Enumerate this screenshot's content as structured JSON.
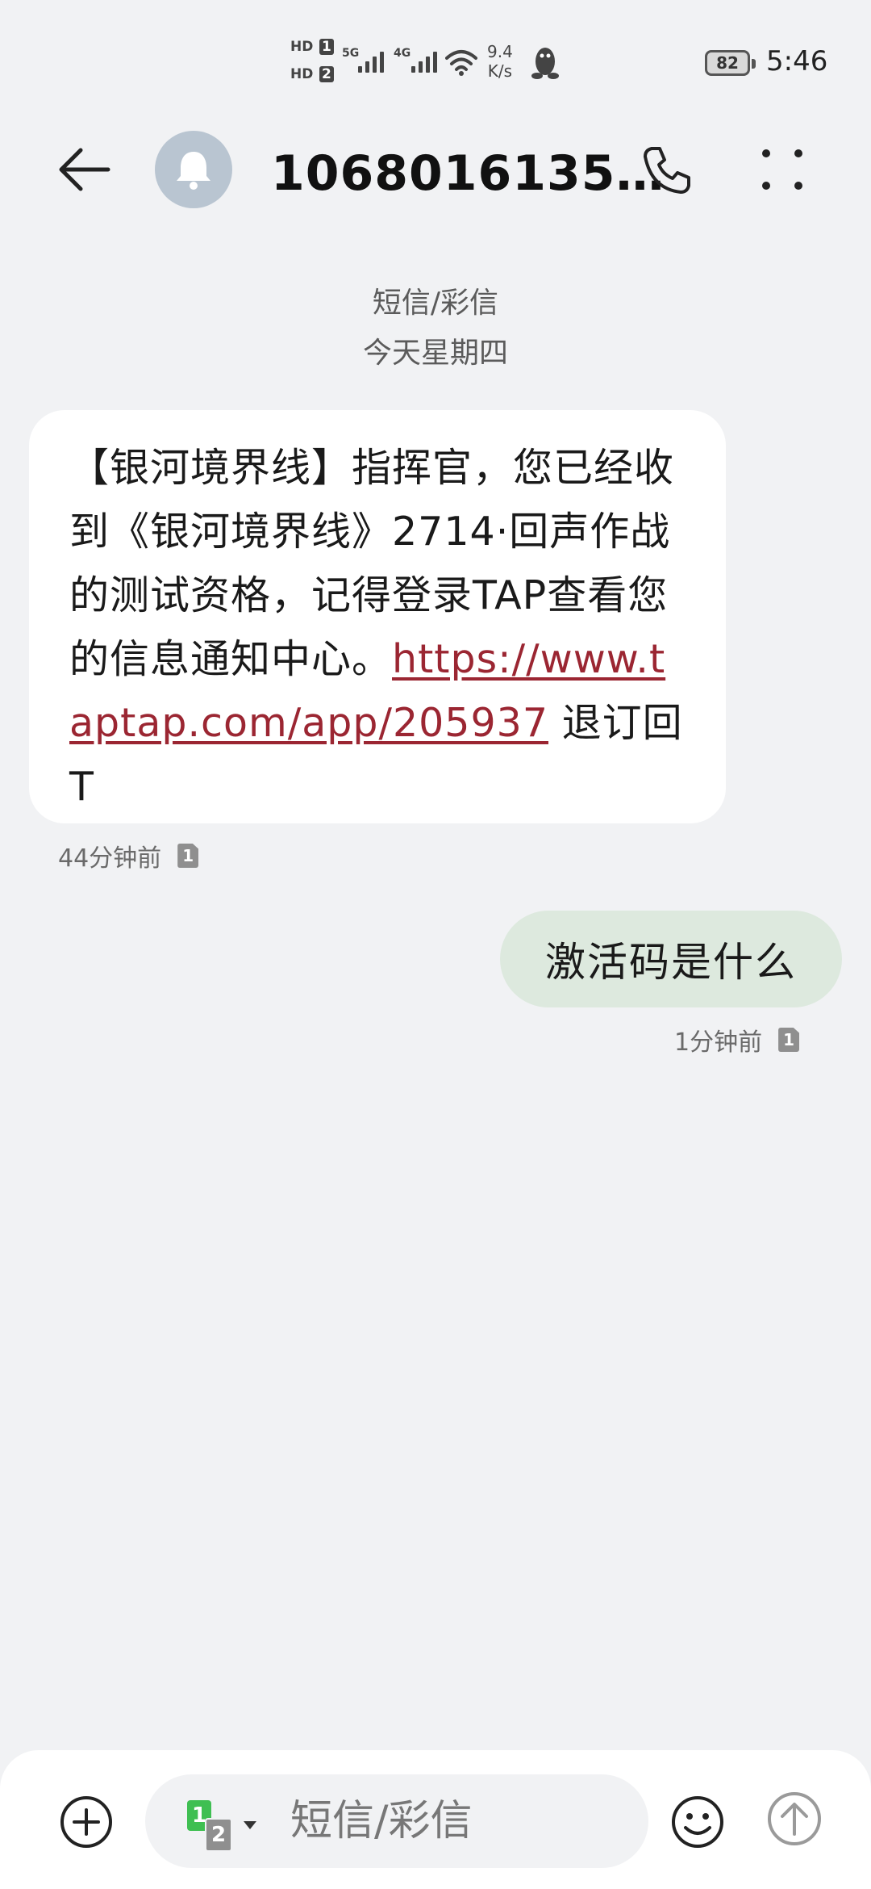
{
  "status_bar": {
    "hd1": "HD",
    "hd1_num": "1",
    "hd2": "HD",
    "hd2_num": "2",
    "net1": "5G",
    "net2": "4G",
    "speed_value": "9.4",
    "speed_unit": "K/s",
    "battery": "82",
    "time": "5:46"
  },
  "header": {
    "contact": "1068016135…"
  },
  "conversation": {
    "channel": "短信/彩信",
    "date": "今天星期四",
    "messages": [
      {
        "direction": "incoming",
        "text_before_link": "【银河境界线】指挥官，您已经收到《银河境界线》2714·回声作战的测试资格，记得登录TAP查看您的信息通知中心。",
        "link": "https://www.taptap.com/app/205937",
        "text_after_link": " 退订回T",
        "time": "44分钟前",
        "sim": "1"
      },
      {
        "direction": "outgoing",
        "text": "激活码是什么",
        "time": "1分钟前",
        "sim": "1"
      }
    ]
  },
  "composer": {
    "sim_primary": "1",
    "sim_secondary": "2",
    "placeholder": "短信/彩信"
  },
  "icons": {
    "back": "back-arrow-icon",
    "avatar": "bell-icon",
    "call": "phone-icon",
    "more": "more-dots-icon",
    "add": "plus-circle-icon",
    "emoji": "emoji-icon",
    "send": "send-up-arrow-icon"
  },
  "colors": {
    "background": "#f1f2f4",
    "incoming_bubble": "#ffffff",
    "outgoing_bubble": "#dde9de",
    "link": "#9b2632",
    "avatar": "#b9c5d1"
  }
}
